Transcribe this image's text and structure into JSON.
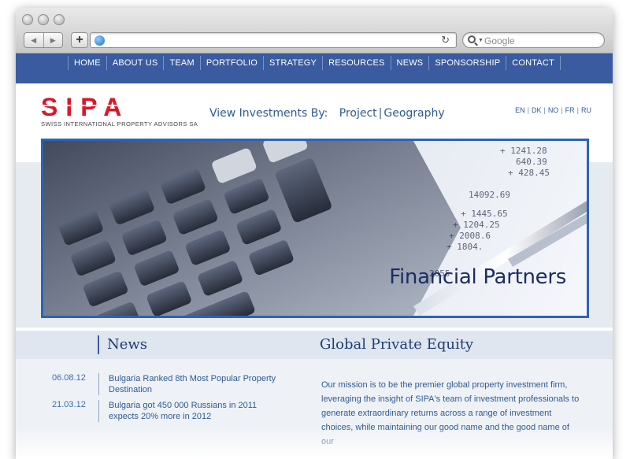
{
  "browser": {
    "search_placeholder": "Google",
    "icons": [
      "back-icon",
      "forward-icon",
      "add-icon",
      "globe-icon",
      "reload-icon",
      "search-icon"
    ]
  },
  "nav": {
    "items": [
      "HOME",
      "ABOUT US",
      "TEAM",
      "PORTFOLIO",
      "STRATEGY",
      "RESOURCES",
      "NEWS",
      "SPONSORSHIP",
      "CONTACT"
    ]
  },
  "header": {
    "logo_text": "SIPA",
    "logo_tagline": "SWISS INTERNATIONAL PROPERTY ADVISORS SA",
    "view_investments_label": "View Investments By:",
    "link_project": "Project",
    "link_geography": "Geography",
    "languages": [
      "EN",
      "DK",
      "NO",
      "FR",
      "RU"
    ]
  },
  "hero": {
    "title": "Financial Partners"
  },
  "news": {
    "heading": "News",
    "items": [
      {
        "date": "06.08.12",
        "title": "Bulgaria Ranked 8th Most Popular Property Destination"
      },
      {
        "date": "21.03.12",
        "title": "Bulgaria got 450 000 Russians in 2011 expects 20% more in 2012"
      }
    ]
  },
  "equity": {
    "heading": "Global Private Equity",
    "text": "Our mission is to be the premier global property investment firm, leveraging the insight of SIPA's team of investment professionals to generate extraordinary returns across a range of investment choices, while maintaining our good name and the good name of our"
  },
  "colors": {
    "nav_bg": "#3a5ba0",
    "logo_red": "#d7192a",
    "link_blue": "#2f5a92",
    "hero_border": "#2d63b3"
  }
}
